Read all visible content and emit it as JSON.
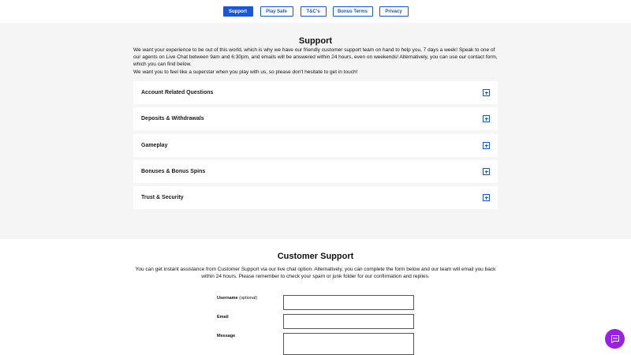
{
  "nav": {
    "tabs": [
      {
        "label": "Support",
        "active": true
      },
      {
        "label": "Play Safe",
        "active": false
      },
      {
        "label": "T&C's",
        "active": false
      },
      {
        "label": "Bonus Terms",
        "active": false
      },
      {
        "label": "Privacy",
        "active": false
      }
    ]
  },
  "support": {
    "title": "Support",
    "intro_1": "We want your experience to be out of this world, which is why we have our friendly customer support team on hand to help you, 7 days a week! Speak to one of our agents on Live Chat between 9am and 6:30pm, and emails will be answered within 24 hours, even on weekends! Alternatively, you can use our contact form, which you can find below.",
    "intro_2": "We want you to feel like a superstar when you play with us, so please don't hesitate to get in touch!",
    "faq": [
      {
        "label": "Account Related Questions"
      },
      {
        "label": "Deposits & Withdrawals"
      },
      {
        "label": "Gameplay"
      },
      {
        "label": "Bonuses & Bonus Spins"
      },
      {
        "label": "Trust & Security"
      }
    ]
  },
  "customer_support": {
    "title": "Customer Support",
    "description": "You can get instant assistance from Customer Support via our live chat option. Alternatively, you can complete the form below and our team will email you back within 24 hours. Please remember to check your spam or junk folder for our confirmation and replies.",
    "form": {
      "username_label": "Username",
      "username_optional": "(optional)",
      "username_value": "",
      "email_label": "Email",
      "email_value": "",
      "message_label": "Message",
      "message_value": ""
    }
  },
  "colors": {
    "accent": "#1a56db",
    "chat_button": "#9b1fe8",
    "section_bg": "#f5f5f5"
  },
  "icons": {
    "accordion": "plus-square-icon",
    "chat": "chat-bubble-icon"
  }
}
